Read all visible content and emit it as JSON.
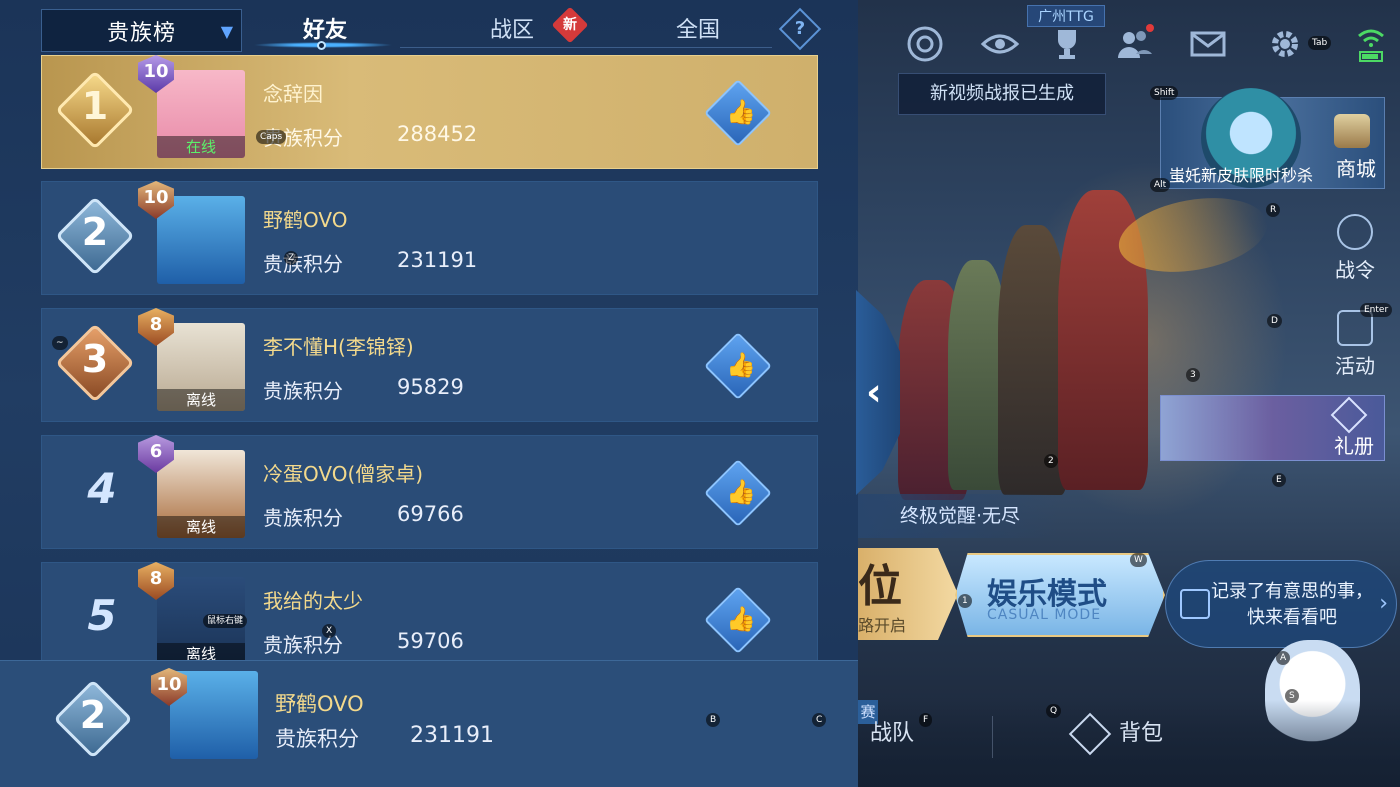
{
  "header": {
    "selector_label": "贵族榜",
    "tabs": [
      {
        "label": "好友",
        "active": true
      },
      {
        "label": "战区",
        "active": false,
        "badge": "新"
      },
      {
        "label": "全国",
        "active": false
      }
    ],
    "help_label": "?"
  },
  "ranking": [
    {
      "rank": "1",
      "vip": "10",
      "name": "念辞因",
      "score_label": "贵族积分",
      "score": "288452",
      "status": "在线",
      "online": true,
      "liked": true
    },
    {
      "rank": "2",
      "vip": "10",
      "name": "野鹤OVO",
      "score_label": "贵族积分",
      "score": "231191",
      "status": "",
      "online": false,
      "liked": false
    },
    {
      "rank": "3",
      "vip": "8",
      "name": "李不懂H(李锦铎)",
      "score_label": "贵族积分",
      "score": "95829",
      "status": "离线",
      "online": false,
      "liked": true
    },
    {
      "rank": "4",
      "vip": "6",
      "name": "冷蛋OVO(僧家卓)",
      "score_label": "贵族积分",
      "score": "69766",
      "status": "离线",
      "online": false,
      "liked": true
    },
    {
      "rank": "5",
      "vip": "8",
      "name": "我给的太少",
      "score_label": "贵族积分",
      "score": "59706",
      "status": "离线",
      "online": false,
      "liked": true
    }
  ],
  "self_row": {
    "rank": "2",
    "vip": "10",
    "name": "野鹤OVO",
    "score_label": "贵族积分",
    "score": "231191"
  },
  "game": {
    "team_tag": "广州TTG",
    "toast": "新视频战报已生成",
    "shop_caption": "蚩奼新皮肤限时秒杀",
    "shop_label": "商城",
    "battlepass_label": "战令",
    "activity_label": "活动",
    "gift_label": "礼册",
    "event_banner": "终极觉醒·无尽",
    "rank_mode_title": "位",
    "rank_mode_sub": "路开启",
    "casual_mode_title": "娱乐模式",
    "casual_mode_sub": "CASUAL MODE",
    "record_text": "记录了有意思的事，快来看看吧",
    "bottom_side_tag": "赛",
    "team_label": "战队",
    "bag_label": "背包"
  },
  "key_hints": {
    "caps": "Caps",
    "tab": "Tab",
    "shift": "Shift",
    "alt": "Alt",
    "enter": "Enter",
    "r": "R",
    "d": "D",
    "e": "E",
    "w": "W",
    "a": "A",
    "s": "S",
    "q": "Q",
    "f": "F",
    "b": "B",
    "c": "C",
    "x": "X",
    "z": "Z",
    "one": "1",
    "two": "2",
    "three": "3",
    "tilde": "~",
    "mouse_right": "鼠标右键"
  },
  "colors": {
    "panel_bg": "#1d3659",
    "row_bg": "#2a4c77",
    "first_row_gold": "#d9bb78",
    "name_gold": "#f3d98c",
    "accent_blue": "#4ab0ff",
    "badge_red": "#d43a3a"
  }
}
